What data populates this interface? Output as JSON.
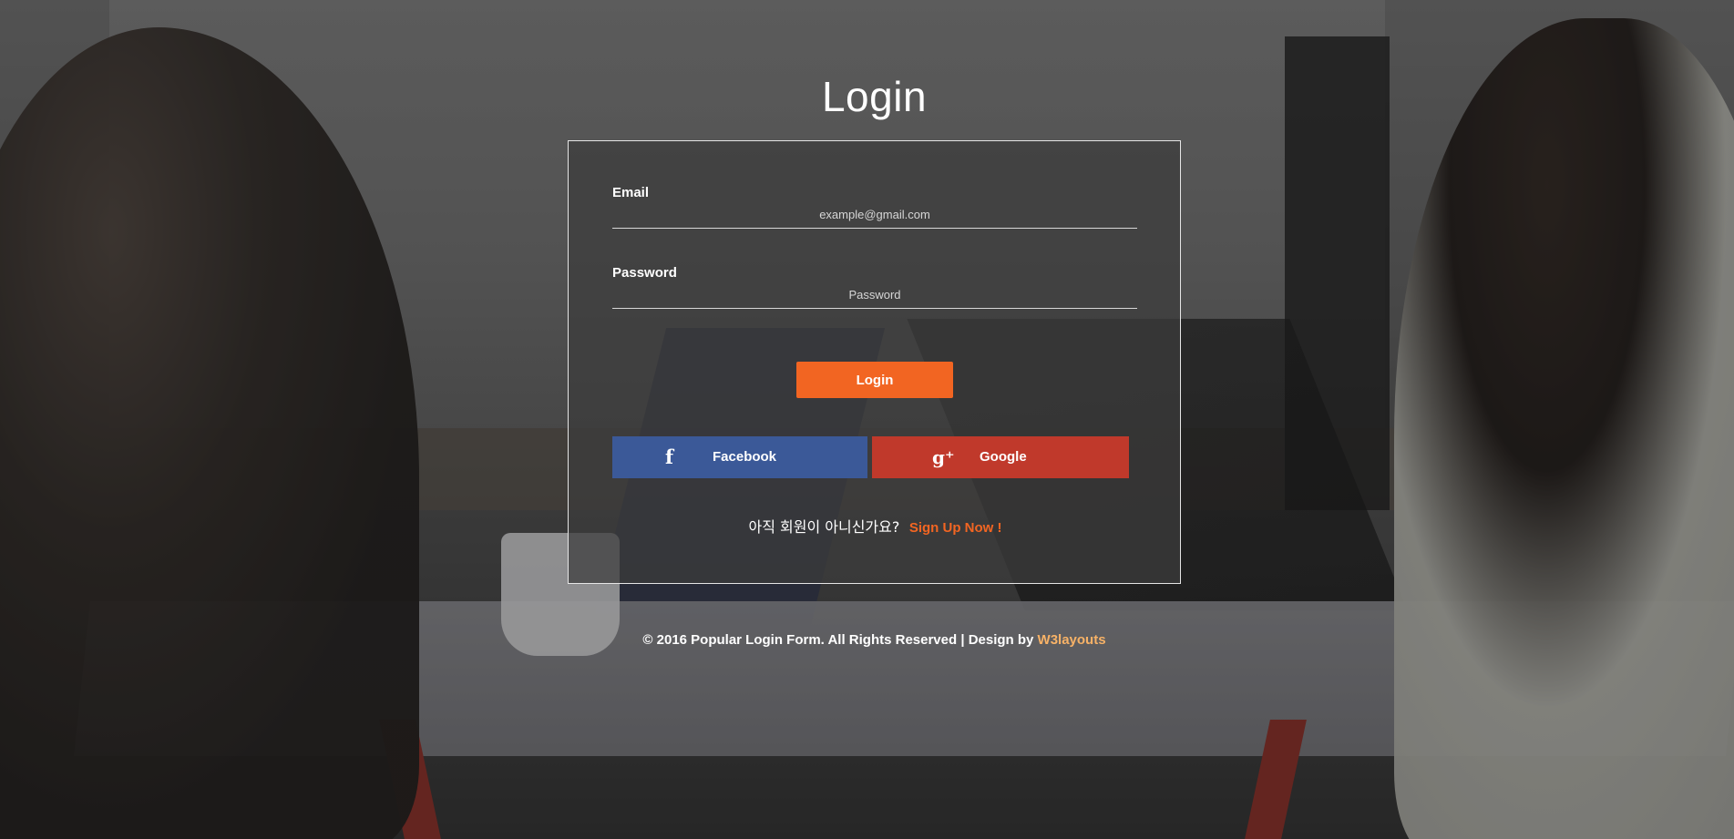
{
  "page": {
    "title": "Login"
  },
  "form": {
    "email_label": "Email",
    "email_placeholder": "example@gmail.com",
    "email_value": "",
    "password_label": "Password",
    "password_placeholder": "Password",
    "password_value": "",
    "login_button_label": "Login"
  },
  "social": {
    "facebook": {
      "label": "Facebook",
      "icon_name": "facebook-icon",
      "icon_glyph": "f",
      "color": "#3b5998"
    },
    "google": {
      "label": "Google",
      "icon_name": "google-plus-icon",
      "icon_glyph": "g⁺",
      "color": "#c0392b"
    }
  },
  "signup": {
    "prompt": "아직 회원이 아니신가요?",
    "link_label": "Sign Up Now !"
  },
  "footer": {
    "text": "© 2016 Popular Login Form. All Rights Reserved | Design by",
    "link_label": "W3layouts"
  },
  "colors": {
    "accent": "#f26522",
    "footer_link": "#f7b267"
  }
}
